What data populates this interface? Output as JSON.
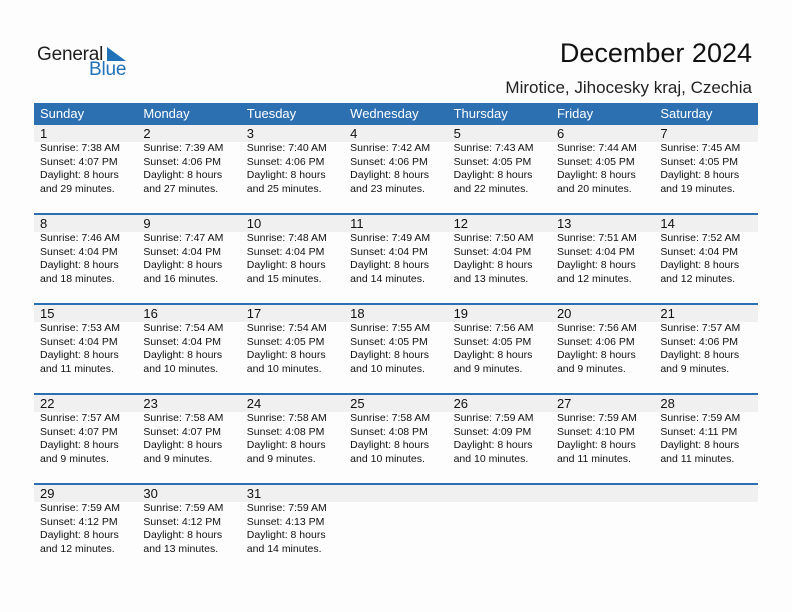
{
  "logo": {
    "line1": "General",
    "line2": "Blue",
    "icon": "triangle-flag-icon",
    "accent": "#2272b9"
  },
  "header": {
    "title": "December 2024",
    "subtitle": "Mirotice, Jihocesky kraj, Czechia"
  },
  "colors": {
    "header_bg": "#2d70b2",
    "date_strip": "#f0f0f0"
  },
  "weekdays": [
    "Sunday",
    "Monday",
    "Tuesday",
    "Wednesday",
    "Thursday",
    "Friday",
    "Saturday"
  ],
  "weeks": [
    [
      {
        "day": "1",
        "sunrise": "Sunrise: 7:38 AM",
        "sunset": "Sunset: 4:07 PM",
        "daylight1": "Daylight: 8 hours",
        "daylight2": "and 29 minutes."
      },
      {
        "day": "2",
        "sunrise": "Sunrise: 7:39 AM",
        "sunset": "Sunset: 4:06 PM",
        "daylight1": "Daylight: 8 hours",
        "daylight2": "and 27 minutes."
      },
      {
        "day": "3",
        "sunrise": "Sunrise: 7:40 AM",
        "sunset": "Sunset: 4:06 PM",
        "daylight1": "Daylight: 8 hours",
        "daylight2": "and 25 minutes."
      },
      {
        "day": "4",
        "sunrise": "Sunrise: 7:42 AM",
        "sunset": "Sunset: 4:06 PM",
        "daylight1": "Daylight: 8 hours",
        "daylight2": "and 23 minutes."
      },
      {
        "day": "5",
        "sunrise": "Sunrise: 7:43 AM",
        "sunset": "Sunset: 4:05 PM",
        "daylight1": "Daylight: 8 hours",
        "daylight2": "and 22 minutes."
      },
      {
        "day": "6",
        "sunrise": "Sunrise: 7:44 AM",
        "sunset": "Sunset: 4:05 PM",
        "daylight1": "Daylight: 8 hours",
        "daylight2": "and 20 minutes."
      },
      {
        "day": "7",
        "sunrise": "Sunrise: 7:45 AM",
        "sunset": "Sunset: 4:05 PM",
        "daylight1": "Daylight: 8 hours",
        "daylight2": "and 19 minutes."
      }
    ],
    [
      {
        "day": "8",
        "sunrise": "Sunrise: 7:46 AM",
        "sunset": "Sunset: 4:04 PM",
        "daylight1": "Daylight: 8 hours",
        "daylight2": "and 18 minutes."
      },
      {
        "day": "9",
        "sunrise": "Sunrise: 7:47 AM",
        "sunset": "Sunset: 4:04 PM",
        "daylight1": "Daylight: 8 hours",
        "daylight2": "and 16 minutes."
      },
      {
        "day": "10",
        "sunrise": "Sunrise: 7:48 AM",
        "sunset": "Sunset: 4:04 PM",
        "daylight1": "Daylight: 8 hours",
        "daylight2": "and 15 minutes."
      },
      {
        "day": "11",
        "sunrise": "Sunrise: 7:49 AM",
        "sunset": "Sunset: 4:04 PM",
        "daylight1": "Daylight: 8 hours",
        "daylight2": "and 14 minutes."
      },
      {
        "day": "12",
        "sunrise": "Sunrise: 7:50 AM",
        "sunset": "Sunset: 4:04 PM",
        "daylight1": "Daylight: 8 hours",
        "daylight2": "and 13 minutes."
      },
      {
        "day": "13",
        "sunrise": "Sunrise: 7:51 AM",
        "sunset": "Sunset: 4:04 PM",
        "daylight1": "Daylight: 8 hours",
        "daylight2": "and 12 minutes."
      },
      {
        "day": "14",
        "sunrise": "Sunrise: 7:52 AM",
        "sunset": "Sunset: 4:04 PM",
        "daylight1": "Daylight: 8 hours",
        "daylight2": "and 12 minutes."
      }
    ],
    [
      {
        "day": "15",
        "sunrise": "Sunrise: 7:53 AM",
        "sunset": "Sunset: 4:04 PM",
        "daylight1": "Daylight: 8 hours",
        "daylight2": "and 11 minutes."
      },
      {
        "day": "16",
        "sunrise": "Sunrise: 7:54 AM",
        "sunset": "Sunset: 4:04 PM",
        "daylight1": "Daylight: 8 hours",
        "daylight2": "and 10 minutes."
      },
      {
        "day": "17",
        "sunrise": "Sunrise: 7:54 AM",
        "sunset": "Sunset: 4:05 PM",
        "daylight1": "Daylight: 8 hours",
        "daylight2": "and 10 minutes."
      },
      {
        "day": "18",
        "sunrise": "Sunrise: 7:55 AM",
        "sunset": "Sunset: 4:05 PM",
        "daylight1": "Daylight: 8 hours",
        "daylight2": "and 10 minutes."
      },
      {
        "day": "19",
        "sunrise": "Sunrise: 7:56 AM",
        "sunset": "Sunset: 4:05 PM",
        "daylight1": "Daylight: 8 hours",
        "daylight2": "and 9 minutes."
      },
      {
        "day": "20",
        "sunrise": "Sunrise: 7:56 AM",
        "sunset": "Sunset: 4:06 PM",
        "daylight1": "Daylight: 8 hours",
        "daylight2": "and 9 minutes."
      },
      {
        "day": "21",
        "sunrise": "Sunrise: 7:57 AM",
        "sunset": "Sunset: 4:06 PM",
        "daylight1": "Daylight: 8 hours",
        "daylight2": "and 9 minutes."
      }
    ],
    [
      {
        "day": "22",
        "sunrise": "Sunrise: 7:57 AM",
        "sunset": "Sunset: 4:07 PM",
        "daylight1": "Daylight: 8 hours",
        "daylight2": "and 9 minutes."
      },
      {
        "day": "23",
        "sunrise": "Sunrise: 7:58 AM",
        "sunset": "Sunset: 4:07 PM",
        "daylight1": "Daylight: 8 hours",
        "daylight2": "and 9 minutes."
      },
      {
        "day": "24",
        "sunrise": "Sunrise: 7:58 AM",
        "sunset": "Sunset: 4:08 PM",
        "daylight1": "Daylight: 8 hours",
        "daylight2": "and 9 minutes."
      },
      {
        "day": "25",
        "sunrise": "Sunrise: 7:58 AM",
        "sunset": "Sunset: 4:08 PM",
        "daylight1": "Daylight: 8 hours",
        "daylight2": "and 10 minutes."
      },
      {
        "day": "26",
        "sunrise": "Sunrise: 7:59 AM",
        "sunset": "Sunset: 4:09 PM",
        "daylight1": "Daylight: 8 hours",
        "daylight2": "and 10 minutes."
      },
      {
        "day": "27",
        "sunrise": "Sunrise: 7:59 AM",
        "sunset": "Sunset: 4:10 PM",
        "daylight1": "Daylight: 8 hours",
        "daylight2": "and 11 minutes."
      },
      {
        "day": "28",
        "sunrise": "Sunrise: 7:59 AM",
        "sunset": "Sunset: 4:11 PM",
        "daylight1": "Daylight: 8 hours",
        "daylight2": "and 11 minutes."
      }
    ],
    [
      {
        "day": "29",
        "sunrise": "Sunrise: 7:59 AM",
        "sunset": "Sunset: 4:12 PM",
        "daylight1": "Daylight: 8 hours",
        "daylight2": "and 12 minutes."
      },
      {
        "day": "30",
        "sunrise": "Sunrise: 7:59 AM",
        "sunset": "Sunset: 4:12 PM",
        "daylight1": "Daylight: 8 hours",
        "daylight2": "and 13 minutes."
      },
      {
        "day": "31",
        "sunrise": "Sunrise: 7:59 AM",
        "sunset": "Sunset: 4:13 PM",
        "daylight1": "Daylight: 8 hours",
        "daylight2": "and 14 minutes."
      },
      null,
      null,
      null,
      null
    ]
  ]
}
